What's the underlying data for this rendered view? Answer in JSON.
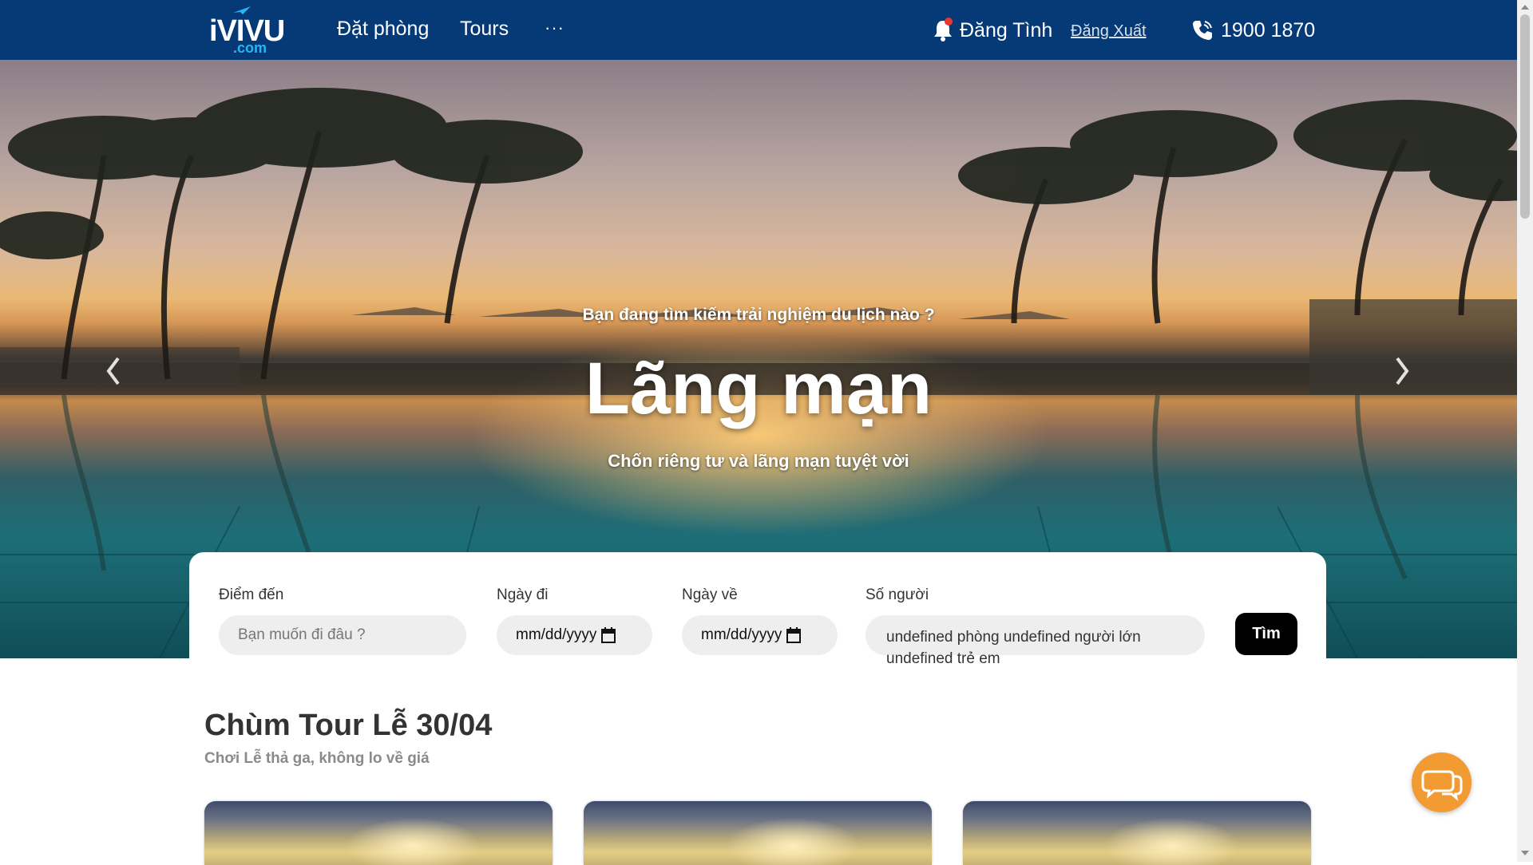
{
  "brand": {
    "logo_text": "iVIVU",
    "logo_domain": ".com",
    "colors": {
      "nav_bg": "#053a76",
      "accent": "#f29b32",
      "button": "#000000"
    }
  },
  "nav": {
    "links": [
      "Đặt phòng",
      "Tours"
    ],
    "more_label": "···",
    "user_name": "Đăng Tình",
    "logout_label": "Đăng Xuất",
    "phone": "1900 1870",
    "icons": {
      "bell": "bell-icon",
      "phone": "phone-icon"
    }
  },
  "hero": {
    "subtitle": "Bạn đang tìm kiếm trải nghiệm du lịch nào ?",
    "title": "Lãng mạn",
    "caption": "Chốn riêng tư và lãng mạn tuyệt vời",
    "prev_icon": "chevron-left-icon",
    "next_icon": "chevron-right-icon"
  },
  "search": {
    "destination_label": "Điểm đến",
    "destination_placeholder": "Bạn muốn đi đâu ?",
    "depart_label": "Ngày đi",
    "depart_value": "mm/dd/yyyy",
    "return_label": "Ngày về",
    "return_value": "mm/dd/yyyy",
    "people_label": "Số người",
    "people_value": "undefined phòng undefined người lớn undefined trẻ em",
    "submit_label": "Tìm"
  },
  "section": {
    "title": "Chùm Tour Lễ 30/04",
    "subtitle": "Chơi Lễ thả ga, không lo về giá"
  },
  "chat_icon": "chat-bubbles-icon"
}
